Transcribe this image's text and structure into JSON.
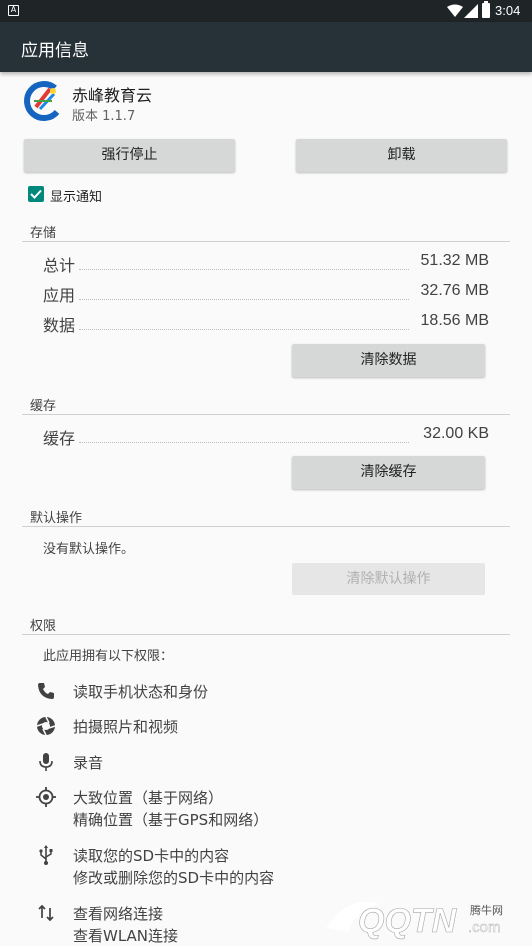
{
  "status_bar": {
    "notification_icon": "a-notification-icon",
    "time": "3:04",
    "icons": [
      "wifi-icon",
      "signal-icon",
      "battery-icon"
    ]
  },
  "app_bar": {
    "title": "应用信息"
  },
  "app": {
    "name": "赤峰教育云",
    "version": "版本 1.1.7",
    "icon": "chifeng-education-cloud-icon"
  },
  "actions": {
    "force_stop": "强行停止",
    "uninstall": "卸载"
  },
  "notifications": {
    "label": "显示通知",
    "checked": true
  },
  "storage": {
    "header": "存储",
    "rows": [
      {
        "label": "总计",
        "value": "51.32 MB"
      },
      {
        "label": "应用",
        "value": "32.76 MB"
      },
      {
        "label": "数据",
        "value": "18.56 MB"
      }
    ],
    "clear_button": "清除数据"
  },
  "cache": {
    "header": "缓存",
    "rows": [
      {
        "label": "缓存",
        "value": "32.00 KB"
      }
    ],
    "clear_button": "清除缓存"
  },
  "defaults": {
    "header": "默认操作",
    "text": "没有默认操作。",
    "clear_button": "清除默认操作"
  },
  "permissions": {
    "header": "权限",
    "intro": "此应用拥有以下权限：",
    "items": [
      {
        "icon": "phone-icon",
        "lines": [
          "读取手机状态和身份"
        ]
      },
      {
        "icon": "camera-icon",
        "lines": [
          "拍摄照片和视频"
        ]
      },
      {
        "icon": "microphone-icon",
        "lines": [
          "录音"
        ]
      },
      {
        "icon": "location-icon",
        "lines": [
          "大致位置（基于网络）",
          "精确位置（基于GPS和网络）"
        ]
      },
      {
        "icon": "usb-icon",
        "lines": [
          "读取您的SD卡中的内容",
          "修改或删除您的SD卡中的内容"
        ]
      },
      {
        "icon": "network-arrows-icon",
        "lines": [
          "查看网络连接",
          "查看WLAN连接"
        ]
      }
    ]
  },
  "watermark": {
    "site": "腾牛网",
    "logo_text": "QQTN.com"
  },
  "colors": {
    "app_bar": "#263238",
    "status_bar": "#1f2427",
    "accent": "#00897b",
    "button": "#d6d7d7"
  }
}
